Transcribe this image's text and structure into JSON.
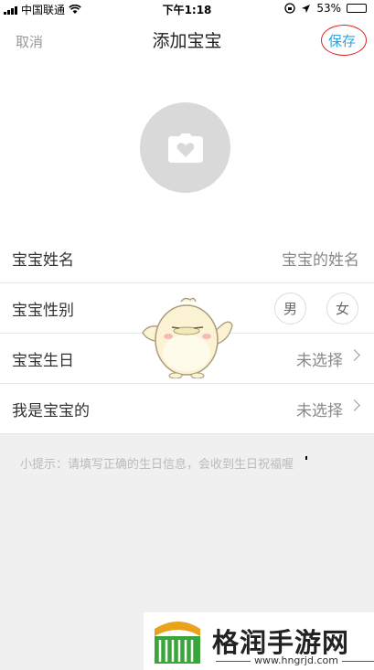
{
  "status_bar": {
    "carrier": "中国联通",
    "time": "下午1:18",
    "battery": "53%",
    "battery_level": 0.53
  },
  "nav": {
    "cancel_label": "取消",
    "title": "添加宝宝",
    "save_label": "保存",
    "save_highlight_color": "#e02020"
  },
  "avatar": {
    "icon": "camera-heart-icon"
  },
  "form": {
    "name": {
      "label": "宝宝姓名",
      "placeholder": "宝宝的姓名"
    },
    "gender": {
      "label": "宝宝性别",
      "options": [
        "男",
        "女"
      ]
    },
    "birthday": {
      "label": "宝宝生日",
      "value": "未选择"
    },
    "relation": {
      "label": "我是宝宝的",
      "value": "未选择"
    }
  },
  "tip": "小提示：请填写正确的生日信息，会收到生日祝福喔",
  "watermark": {
    "text": "格润手游网",
    "url": "www.hngrjd.com"
  },
  "colors": {
    "accent": "#2aa6e0",
    "background": "#f0f0f0"
  }
}
